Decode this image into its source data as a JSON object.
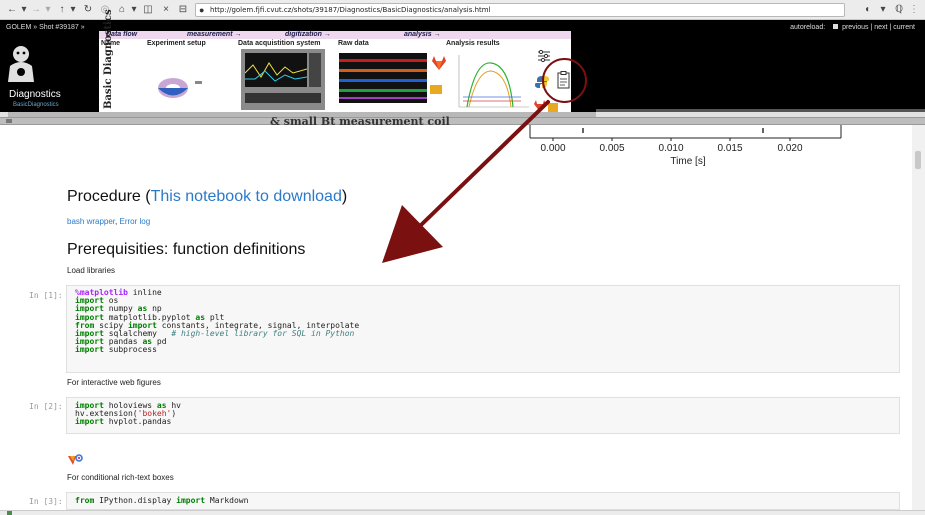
{
  "browser": {
    "url": "http://golem.fjfi.cvut.cz/shots/39187/Diagnostics/BasicDiagnostics/analysis.html",
    "nav_icons": [
      "back-icon",
      "forward-icon",
      "up-icon",
      "reload-icon",
      "stop-icon",
      "home-icon",
      "sidebar-icon",
      "close-icon",
      "tabs-icon"
    ]
  },
  "header": {
    "title": "GOLEM » Shot #39187 »",
    "autoreload": "autoreload:",
    "previous": "previous",
    "next": "next",
    "current": "current",
    "side_label": "Diagnostics",
    "side_sub": "BasicDiagnostics",
    "vertical_label": "Basic Diagnostics",
    "flow": [
      "Data flow",
      "measurement →",
      "digitization →",
      "analysis →"
    ],
    "columns": [
      "Name",
      "Experiment setup",
      "Data acquistition system",
      "Raw data",
      "Analysis results"
    ]
  },
  "plot": {
    "caption": "& small Bt measurement coil",
    "ticks": [
      "0.000",
      "0.005",
      "0.010",
      "0.015",
      "0.020"
    ],
    "x_label": "Time [s]"
  },
  "notebook": {
    "procedure_prefix": "Procedure (",
    "procedure_link": "This notebook to download",
    "procedure_suffix": ")",
    "bash_wrapper": "bash wrapper",
    "sep": ", ",
    "error_log": "Error log",
    "prereq_heading": "Prerequisities: function definitions",
    "load_libraries": "Load libraries",
    "interactive_text": "For interactive web figures",
    "conditional_text": "For conditional rich-text boxes",
    "cells": [
      {
        "prompt": "In [1]:"
      },
      {
        "prompt": "In [2]:"
      },
      {
        "prompt": "In [3]:"
      }
    ]
  },
  "colors": {
    "link": "#2a7ac9",
    "keyword": "#008000",
    "magic": "#aa22ff",
    "comment": "#408080",
    "string": "#ba2121",
    "annotation": "#7a1010"
  }
}
